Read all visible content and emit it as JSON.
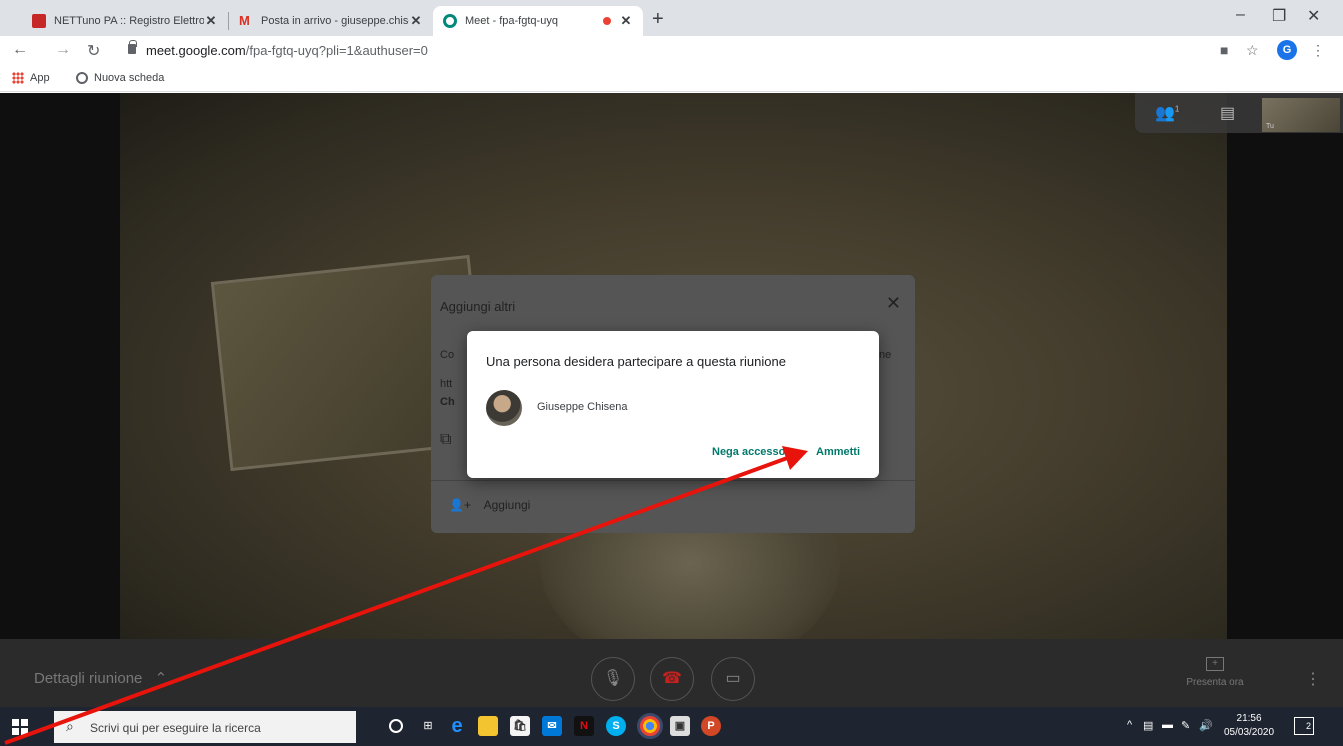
{
  "browser": {
    "tabs": [
      {
        "title": "NETTuno PA :: Registro Elettronic",
        "active": false,
        "favicon": "shield-icon"
      },
      {
        "title": "Posta in arrivo - giuseppe.chisen",
        "active": false,
        "favicon": "gmail-icon"
      },
      {
        "title": "Meet - fpa-fgtq-uyq",
        "active": true,
        "favicon": "meet-icon",
        "recording": true
      }
    ],
    "close_glyph": "✕",
    "new_tab_glyph": "+",
    "url_host": "meet.google.com",
    "url_path": "/fpa-fgtq-uyq?pli=1&authuser=0",
    "profile_initial": "G",
    "bookmarks": [
      "App",
      "Nuova scheda"
    ]
  },
  "meet": {
    "details_label": "Dettagli riunione",
    "present_label": "Presenta ora",
    "self_label": "Tu",
    "people_count": "1",
    "add_dialog": {
      "title": "Aggiungi altri",
      "partial_line1_left": "Co",
      "partial_line1_right": "ne",
      "partial_line2": "htt",
      "partial_line3": "Ch",
      "add_label": "Aggiungi"
    },
    "admit_dialog": {
      "message": "Una persona desidera partecipare a questa riunione",
      "requester_name": "Giuseppe Chisena",
      "deny_label": "Nega accesso",
      "admit_label": "Ammetti"
    }
  },
  "taskbar": {
    "search_placeholder": "Scrivi qui per eseguire la ricerca",
    "time": "21:56",
    "date": "05/03/2020",
    "notification_count": "2"
  },
  "colors": {
    "accent_teal": "#00796b",
    "annotation_red": "#e8140c",
    "hangup_red": "#c5221f"
  }
}
